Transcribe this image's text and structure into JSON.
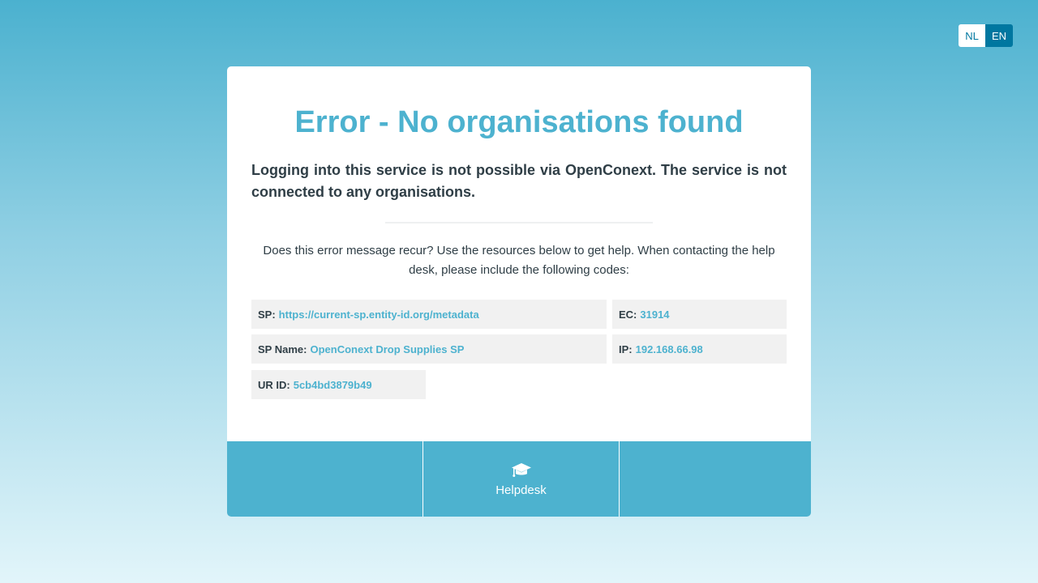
{
  "language_switch": {
    "nl_label": "NL",
    "en_label": "EN",
    "active": "EN"
  },
  "error": {
    "title": "Error - No organisations found",
    "subtitle": "Logging into this service is not possible via OpenConext. The service is not connected to any organisations.",
    "help_text": "Does this error message recur? Use the resources below to get help. When contacting the help desk, please include the following codes:"
  },
  "codes": {
    "sp": {
      "label": "SP:",
      "value": "https://current-sp.entity-id.org/metadata"
    },
    "ec": {
      "label": "EC:",
      "value": "31914"
    },
    "sp_name": {
      "label": "SP Name:",
      "value": "OpenConext Drop Supplies SP"
    },
    "ip": {
      "label": "IP:",
      "value": "192.168.66.98"
    },
    "ur_id": {
      "label": "UR ID:",
      "value": "5cb4bd3879b49"
    }
  },
  "footer": {
    "helpdesk_label": "Helpdesk",
    "helpdesk_icon": "graduation-cap-icon"
  },
  "colors": {
    "accent": "#4db2cf",
    "active_lang": "#0077a0",
    "text": "#2f3e46",
    "code_bg": "#f1f1f1"
  }
}
